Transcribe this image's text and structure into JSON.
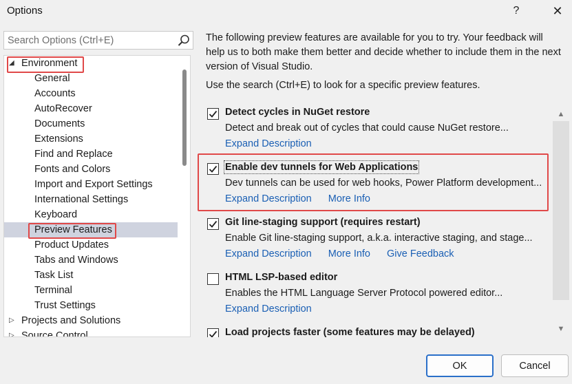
{
  "window": {
    "title": "Options",
    "help_label": "?",
    "close_label": "✕"
  },
  "search": {
    "placeholder": "Search Options (Ctrl+E)",
    "value": ""
  },
  "tree": {
    "items": [
      {
        "label": "Environment",
        "level": 0,
        "expander": "◢",
        "selected": false
      },
      {
        "label": "General",
        "level": 1
      },
      {
        "label": "Accounts",
        "level": 1
      },
      {
        "label": "AutoRecover",
        "level": 1
      },
      {
        "label": "Documents",
        "level": 1
      },
      {
        "label": "Extensions",
        "level": 1
      },
      {
        "label": "Find and Replace",
        "level": 1
      },
      {
        "label": "Fonts and Colors",
        "level": 1
      },
      {
        "label": "Import and Export Settings",
        "level": 1
      },
      {
        "label": "International Settings",
        "level": 1
      },
      {
        "label": "Keyboard",
        "level": 1
      },
      {
        "label": "Preview Features",
        "level": 1,
        "selected": true
      },
      {
        "label": "Product Updates",
        "level": 1
      },
      {
        "label": "Tabs and Windows",
        "level": 1
      },
      {
        "label": "Task List",
        "level": 1
      },
      {
        "label": "Terminal",
        "level": 1
      },
      {
        "label": "Trust Settings",
        "level": 1
      },
      {
        "label": "Projects and Solutions",
        "level": 0,
        "expander": "▷"
      },
      {
        "label": "Source Control",
        "level": 0,
        "expander": "▷"
      }
    ]
  },
  "intro": {
    "text": "The following preview features are available for you to try. Your feedback will help us to both make them better and decide whether to include them in the next version of Visual Studio.",
    "hint": "Use the search (Ctrl+E) to look for a specific preview features."
  },
  "features": [
    {
      "title": "Detect cycles in NuGet restore",
      "checked": true,
      "description": "Detect and break out of cycles that could cause NuGet restore...",
      "links": [
        "Expand Description"
      ]
    },
    {
      "title": "Enable dev tunnels for Web Applications",
      "checked": true,
      "focused": true,
      "description": "Dev tunnels can be used for web hooks, Power Platform development...",
      "links": [
        "Expand Description",
        "More Info"
      ]
    },
    {
      "title": "Git line-staging support (requires restart)",
      "checked": true,
      "description": "Enable Git line-staging support, a.k.a. interactive staging, and stage...",
      "links": [
        "Expand Description",
        "More Info",
        "Give Feedback"
      ]
    },
    {
      "title": "HTML LSP-based editor",
      "checked": false,
      "description": "Enables the HTML Language Server Protocol powered editor...",
      "links": [
        "Expand Description"
      ]
    },
    {
      "title": "Load projects faster (some features may be delayed)",
      "checked": true,
      "description": "",
      "links": []
    }
  ],
  "buttons": {
    "ok": "OK",
    "cancel": "Cancel"
  },
  "colors": {
    "link": "#1a5fb4",
    "highlight_box": "#e04848",
    "selection": "#cfd3df",
    "ok_border": "#2a6fc9"
  }
}
